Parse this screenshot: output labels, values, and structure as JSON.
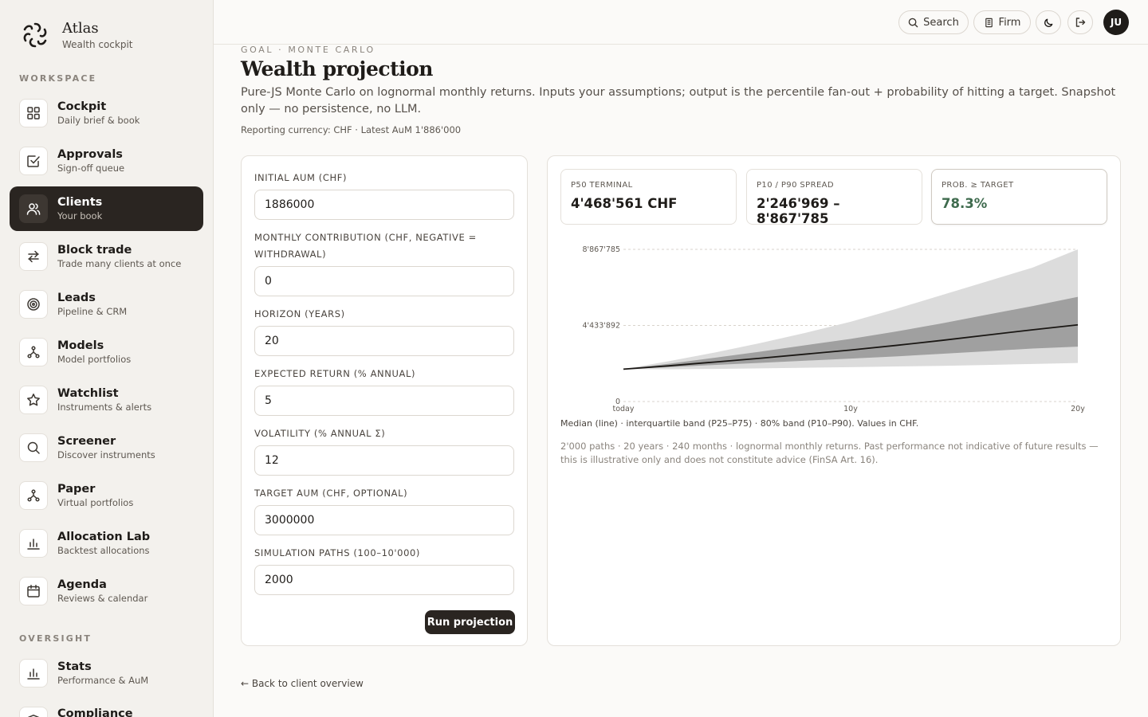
{
  "brand": {
    "name": "Atlas",
    "subtitle": "Wealth cockpit"
  },
  "sidebar": {
    "sections": [
      "WORKSPACE",
      "OVERSIGHT"
    ],
    "items": [
      {
        "label": "Cockpit",
        "sub": "Daily brief & book",
        "icon": "grid-icon"
      },
      {
        "label": "Approvals",
        "sub": "Sign-off queue",
        "icon": "check-square-icon"
      },
      {
        "label": "Clients",
        "sub": "Your book",
        "icon": "users-icon",
        "active": true
      },
      {
        "label": "Block trade",
        "sub": "Trade many clients at once",
        "icon": "arrows-swap-icon"
      },
      {
        "label": "Leads",
        "sub": "Pipeline & CRM",
        "icon": "target-icon"
      },
      {
        "label": "Models",
        "sub": "Model portfolios",
        "icon": "share-nodes-icon"
      },
      {
        "label": "Watchlist",
        "sub": "Instruments & alerts",
        "icon": "star-icon"
      },
      {
        "label": "Screener",
        "sub": "Discover instruments",
        "icon": "search-icon"
      },
      {
        "label": "Paper",
        "sub": "Virtual portfolios",
        "icon": "share-nodes-icon"
      },
      {
        "label": "Allocation Lab",
        "sub": "Backtest allocations",
        "icon": "bar-chart-icon"
      },
      {
        "label": "Agenda",
        "sub": "Reviews & calendar",
        "icon": "calendar-icon"
      }
    ],
    "oversight_items": [
      {
        "label": "Stats",
        "sub": "Performance & AuM",
        "icon": "bar-chart-icon"
      },
      {
        "label": "Compliance",
        "sub": "",
        "icon": "shield-icon"
      }
    ]
  },
  "topbar": {
    "search_label": "Search",
    "firm_label": "Firm",
    "avatar_initials": "JU"
  },
  "page": {
    "eyebrow": "GOAL · MONTE CARLO",
    "title": "Wealth projection",
    "description": "Pure-JS Monte Carlo on lognormal monthly returns. Inputs your assumptions; output is the percentile fan-out + probability of hitting a target. Snapshot only — no persistence, no LLM.",
    "meta": "Reporting currency: CHF · Latest AuM 1'886'000"
  },
  "form": {
    "fields": [
      {
        "label": "INITIAL AUM (CHF)",
        "value": "1886000"
      },
      {
        "label": "MONTHLY CONTRIBUTION (CHF, NEGATIVE = WITHDRAWAL)",
        "value": "0"
      },
      {
        "label": "HORIZON (YEARS)",
        "value": "20"
      },
      {
        "label": "EXPECTED RETURN (% ANNUAL)",
        "value": "5"
      },
      {
        "label": "VOLATILITY (% ANNUAL Σ)",
        "value": "12"
      },
      {
        "label": "TARGET AUM (CHF, OPTIONAL)",
        "value": "3000000"
      },
      {
        "label": "SIMULATION PATHS (100–10'000)",
        "value": "2000"
      }
    ],
    "run_label": "Run projection"
  },
  "stats": [
    {
      "label": "P50 TERMINAL",
      "value": "4'468'561 CHF"
    },
    {
      "label": "P10 / P90 SPREAD",
      "value": "2'246'969 – 8'867'785"
    },
    {
      "label": "PROB. ≥ TARGET",
      "value": "78.3%"
    }
  ],
  "chart_data": {
    "type": "area",
    "x": [
      0,
      2,
      4,
      6,
      8,
      10,
      12,
      14,
      16,
      18,
      20
    ],
    "x_tick_labels": [
      "today",
      "10y",
      "20y"
    ],
    "y_tick_labels": [
      "8'867'785",
      "4'433'892",
      "0"
    ],
    "ylim": [
      0,
      8867785
    ],
    "series": [
      {
        "name": "P10",
        "values": [
          1886000,
          1880000,
          1900000,
          1930000,
          1970000,
          2000000,
          2040000,
          2080000,
          2130000,
          2190000,
          2246969
        ]
      },
      {
        "name": "P25",
        "values": [
          1886000,
          2000000,
          2130000,
          2250000,
          2380000,
          2500000,
          2630000,
          2780000,
          2930000,
          3090000,
          3200000
        ]
      },
      {
        "name": "P50",
        "values": [
          1886000,
          2080000,
          2300000,
          2520000,
          2760000,
          3000000,
          3270000,
          3560000,
          3870000,
          4180000,
          4468561
        ]
      },
      {
        "name": "P75",
        "values": [
          1886000,
          2200000,
          2550000,
          2900000,
          3280000,
          3650000,
          4080000,
          4550000,
          5060000,
          5560000,
          6100000
        ]
      },
      {
        "name": "P90",
        "values": [
          1886000,
          2350000,
          2850000,
          3400000,
          4000000,
          4650000,
          5400000,
          6200000,
          7000000,
          7800000,
          8867785
        ]
      }
    ],
    "caption": "Median (line) · interquartile band (P25–P75) · 80% band (P10–P90). Values in CHF.",
    "grid": true
  },
  "note": "2'000 paths · 20 years · 240 months · lognormal monthly returns. Past performance not indicative of future results — this is illustrative only and does not constitute advice (FinSA Art. 16).",
  "back_link": "← Back to client overview"
}
